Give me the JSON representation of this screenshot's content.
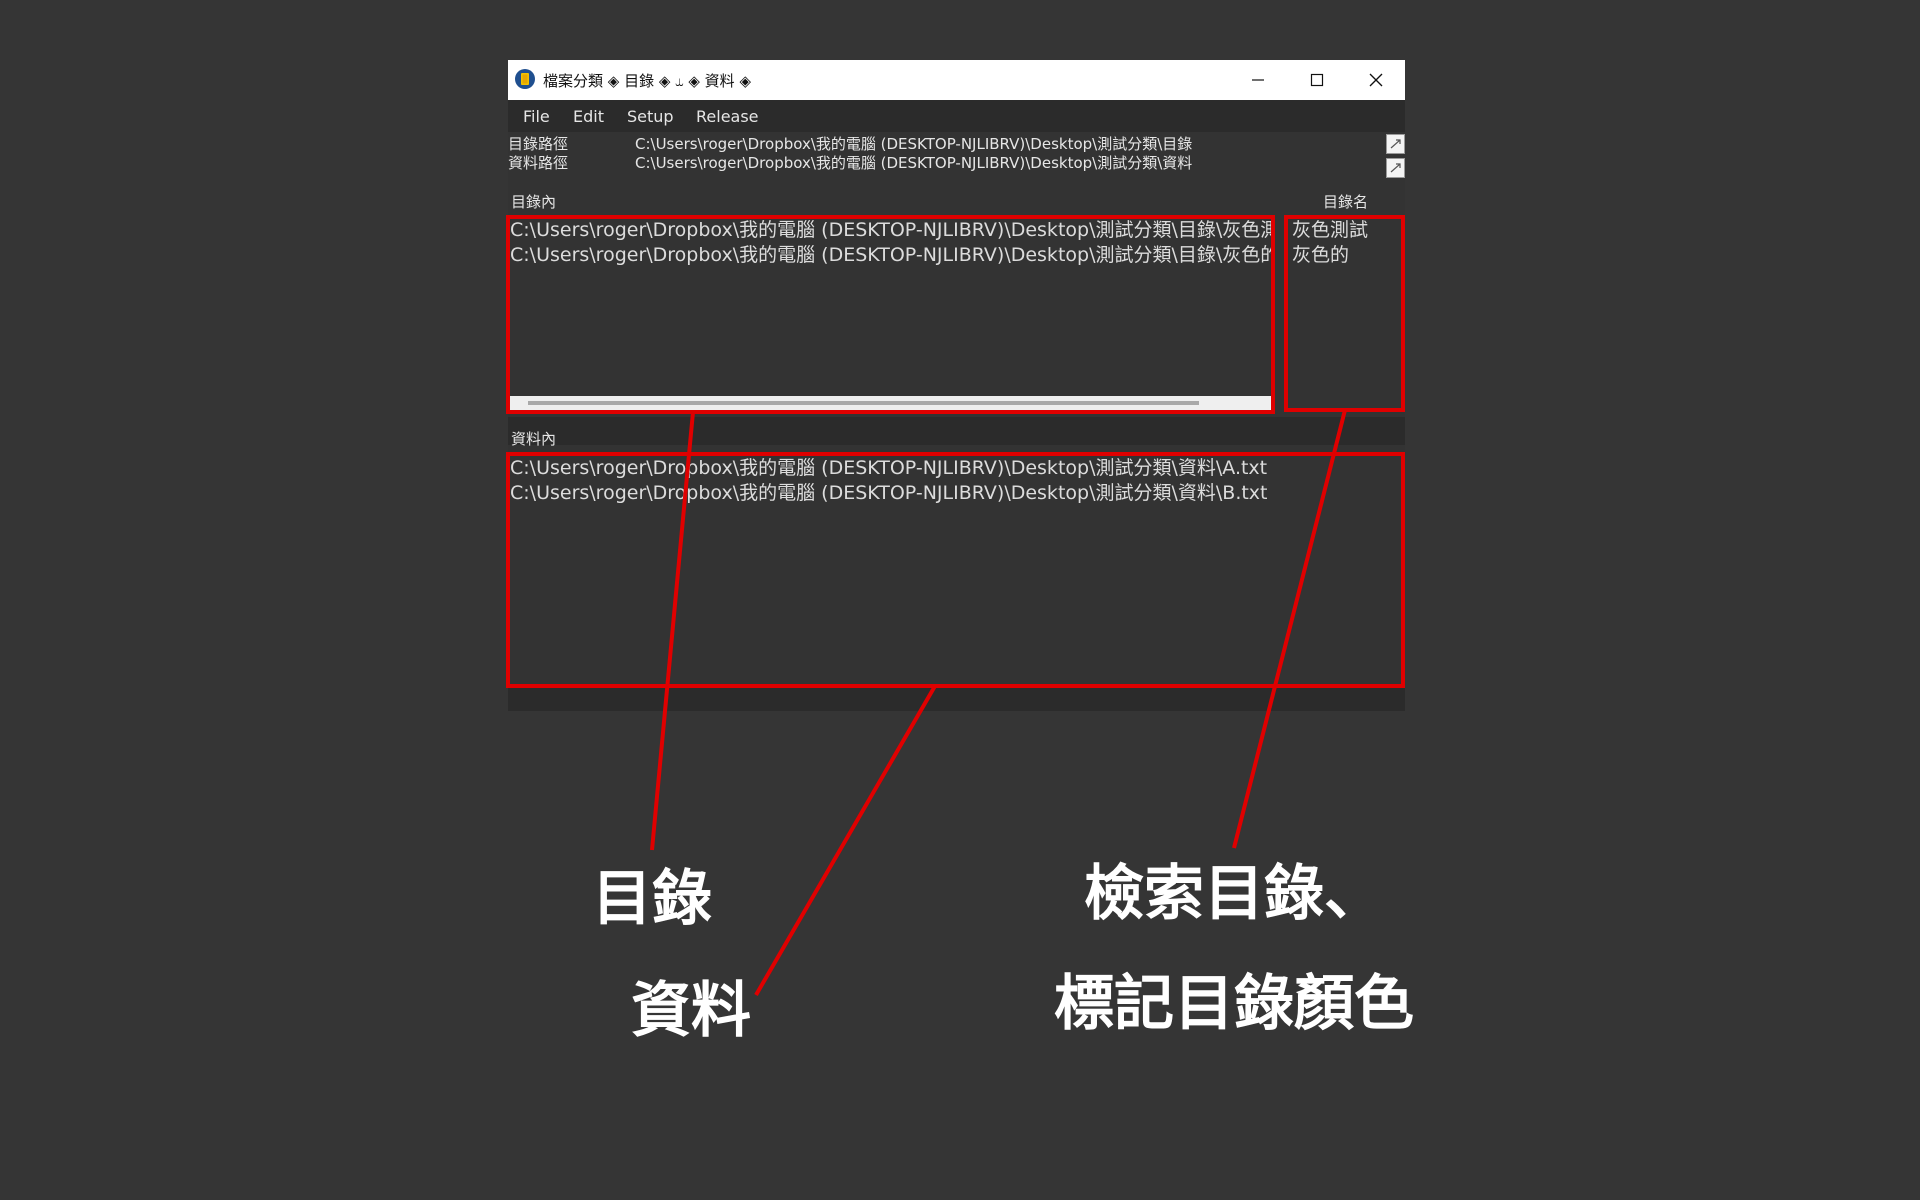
{
  "window": {
    "title": "檔案分類 ◈ 目錄 ◈ ⥿ ◈ 資料 ◈",
    "minimize_icon": "minimize-icon",
    "maximize_icon": "maximize-icon",
    "close_icon": "close-icon"
  },
  "menu": [
    "File",
    "Edit",
    "Setup",
    "Release"
  ],
  "paths": {
    "dir_label": "目錄路徑",
    "dir_value": "C:\\Users\\roger\\Dropbox\\我的電腦 (DESKTOP-NJLIBRV)\\Desktop\\測試分類\\目錄",
    "data_label": "資料路徑",
    "data_value": "C:\\Users\\roger\\Dropbox\\我的電腦 (DESKTOP-NJLIBRV)\\Desktop\\測試分類\\資料"
  },
  "dir_section": {
    "label": "目錄內",
    "name_label": "目錄名",
    "rows": [
      "C:\\Users\\roger\\Dropbox\\我的電腦 (DESKTOP-NJLIBRV)\\Desktop\\測試分類\\目錄\\灰色測試",
      "C:\\Users\\roger\\Dropbox\\我的電腦 (DESKTOP-NJLIBRV)\\Desktop\\測試分類\\目錄\\灰色的"
    ],
    "names": [
      "灰色測試",
      "灰色的"
    ]
  },
  "data_section": {
    "label": "資料內",
    "rows": [
      "C:\\Users\\roger\\Dropbox\\我的電腦 (DESKTOP-NJLIBRV)\\Desktop\\測試分類\\資料\\A.txt",
      "C:\\Users\\roger\\Dropbox\\我的電腦 (DESKTOP-NJLIBRV)\\Desktop\\測試分類\\資料\\B.txt"
    ]
  },
  "annotations": {
    "dir": "目錄",
    "data": "資料",
    "search_line1": "檢索目錄、",
    "search_line2": "標記目錄顏色"
  },
  "colors": {
    "background": "#353535",
    "annotation_red": "#e00000",
    "titlebar": "#ffffff",
    "panel": "#333333"
  }
}
